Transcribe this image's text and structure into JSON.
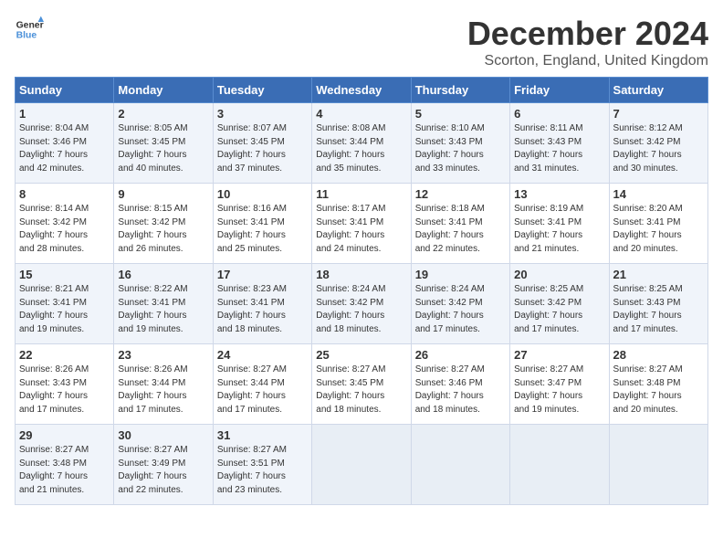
{
  "logo": {
    "line1": "General",
    "line2": "Blue"
  },
  "title": "December 2024",
  "subtitle": "Scorton, England, United Kingdom",
  "headers": [
    "Sunday",
    "Monday",
    "Tuesday",
    "Wednesday",
    "Thursday",
    "Friday",
    "Saturday"
  ],
  "weeks": [
    [
      {
        "day": "1",
        "sunrise": "8:04 AM",
        "sunset": "3:46 PM",
        "daylight": "7 hours and 42 minutes."
      },
      {
        "day": "2",
        "sunrise": "8:05 AM",
        "sunset": "3:45 PM",
        "daylight": "7 hours and 40 minutes."
      },
      {
        "day": "3",
        "sunrise": "8:07 AM",
        "sunset": "3:45 PM",
        "daylight": "7 hours and 37 minutes."
      },
      {
        "day": "4",
        "sunrise": "8:08 AM",
        "sunset": "3:44 PM",
        "daylight": "7 hours and 35 minutes."
      },
      {
        "day": "5",
        "sunrise": "8:10 AM",
        "sunset": "3:43 PM",
        "daylight": "7 hours and 33 minutes."
      },
      {
        "day": "6",
        "sunrise": "8:11 AM",
        "sunset": "3:43 PM",
        "daylight": "7 hours and 31 minutes."
      },
      {
        "day": "7",
        "sunrise": "8:12 AM",
        "sunset": "3:42 PM",
        "daylight": "7 hours and 30 minutes."
      }
    ],
    [
      {
        "day": "8",
        "sunrise": "8:14 AM",
        "sunset": "3:42 PM",
        "daylight": "7 hours and 28 minutes."
      },
      {
        "day": "9",
        "sunrise": "8:15 AM",
        "sunset": "3:42 PM",
        "daylight": "7 hours and 26 minutes."
      },
      {
        "day": "10",
        "sunrise": "8:16 AM",
        "sunset": "3:41 PM",
        "daylight": "7 hours and 25 minutes."
      },
      {
        "day": "11",
        "sunrise": "8:17 AM",
        "sunset": "3:41 PM",
        "daylight": "7 hours and 24 minutes."
      },
      {
        "day": "12",
        "sunrise": "8:18 AM",
        "sunset": "3:41 PM",
        "daylight": "7 hours and 22 minutes."
      },
      {
        "day": "13",
        "sunrise": "8:19 AM",
        "sunset": "3:41 PM",
        "daylight": "7 hours and 21 minutes."
      },
      {
        "day": "14",
        "sunrise": "8:20 AM",
        "sunset": "3:41 PM",
        "daylight": "7 hours and 20 minutes."
      }
    ],
    [
      {
        "day": "15",
        "sunrise": "8:21 AM",
        "sunset": "3:41 PM",
        "daylight": "7 hours and 19 minutes."
      },
      {
        "day": "16",
        "sunrise": "8:22 AM",
        "sunset": "3:41 PM",
        "daylight": "7 hours and 19 minutes."
      },
      {
        "day": "17",
        "sunrise": "8:23 AM",
        "sunset": "3:41 PM",
        "daylight": "7 hours and 18 minutes."
      },
      {
        "day": "18",
        "sunrise": "8:24 AM",
        "sunset": "3:42 PM",
        "daylight": "7 hours and 18 minutes."
      },
      {
        "day": "19",
        "sunrise": "8:24 AM",
        "sunset": "3:42 PM",
        "daylight": "7 hours and 17 minutes."
      },
      {
        "day": "20",
        "sunrise": "8:25 AM",
        "sunset": "3:42 PM",
        "daylight": "7 hours and 17 minutes."
      },
      {
        "day": "21",
        "sunrise": "8:25 AM",
        "sunset": "3:43 PM",
        "daylight": "7 hours and 17 minutes."
      }
    ],
    [
      {
        "day": "22",
        "sunrise": "8:26 AM",
        "sunset": "3:43 PM",
        "daylight": "7 hours and 17 minutes."
      },
      {
        "day": "23",
        "sunrise": "8:26 AM",
        "sunset": "3:44 PM",
        "daylight": "7 hours and 17 minutes."
      },
      {
        "day": "24",
        "sunrise": "8:27 AM",
        "sunset": "3:44 PM",
        "daylight": "7 hours and 17 minutes."
      },
      {
        "day": "25",
        "sunrise": "8:27 AM",
        "sunset": "3:45 PM",
        "daylight": "7 hours and 18 minutes."
      },
      {
        "day": "26",
        "sunrise": "8:27 AM",
        "sunset": "3:46 PM",
        "daylight": "7 hours and 18 minutes."
      },
      {
        "day": "27",
        "sunrise": "8:27 AM",
        "sunset": "3:47 PM",
        "daylight": "7 hours and 19 minutes."
      },
      {
        "day": "28",
        "sunrise": "8:27 AM",
        "sunset": "3:48 PM",
        "daylight": "7 hours and 20 minutes."
      }
    ],
    [
      {
        "day": "29",
        "sunrise": "8:27 AM",
        "sunset": "3:48 PM",
        "daylight": "7 hours and 21 minutes."
      },
      {
        "day": "30",
        "sunrise": "8:27 AM",
        "sunset": "3:49 PM",
        "daylight": "7 hours and 22 minutes."
      },
      {
        "day": "31",
        "sunrise": "8:27 AM",
        "sunset": "3:51 PM",
        "daylight": "7 hours and 23 minutes."
      },
      null,
      null,
      null,
      null
    ]
  ],
  "labels": {
    "sunrise": "Sunrise:",
    "sunset": "Sunset:",
    "daylight": "Daylight:"
  }
}
